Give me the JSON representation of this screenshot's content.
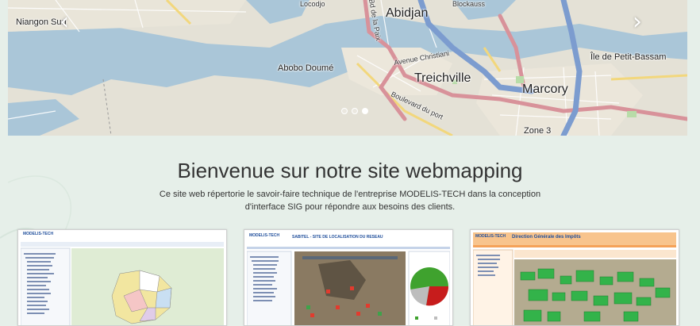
{
  "carousel": {
    "prev_icon": "chevron-left-icon",
    "next_icon": "chevron-right-icon",
    "active_slide": 3,
    "slide_count": 3,
    "map_labels": {
      "niangon": "Niangon Sud",
      "locodjo": "Locodjo",
      "abidjan": "Abidjan",
      "blockauss": "Blockauss",
      "abobo": "Abobo Doumé",
      "avenue": "Avenue Christiani",
      "treichville": "Treichville",
      "marcory": "Marcory",
      "ile": "Île de Petit-Bassam",
      "zone3": "Zone 3",
      "boulevard": "Boulevard du port",
      "bd_lagunaire": "Bd de la Paix"
    }
  },
  "welcome": {
    "title": "Bienvenue sur notre site webmapping",
    "intro_line1": "Ce site web répertorie le savoir-faire technique de l'entreprise MODELIS-TECH dans la conception",
    "intro_line2": "d'interface SIG pour répondre aux besoins des clients."
  },
  "thumbnails": [
    {
      "brand": "MODELIS-TECH"
    },
    {
      "brand": "MODELIS-TECH",
      "title": "SABITEL - SITE DE LOCALISATION DU RESEAU"
    },
    {
      "brand": "MODELIS-TECH",
      "title": "Direction Générale des Impôts"
    }
  ],
  "colors": {
    "page_bg": "#e6efe9",
    "water": "#a9c6d9",
    "land": "#e5e2d6",
    "highway_blue": "#7c9ccf",
    "road_red": "#d8929a",
    "orange_header": "#f5a259",
    "thumb_blue_title": "#1f4e9b"
  }
}
